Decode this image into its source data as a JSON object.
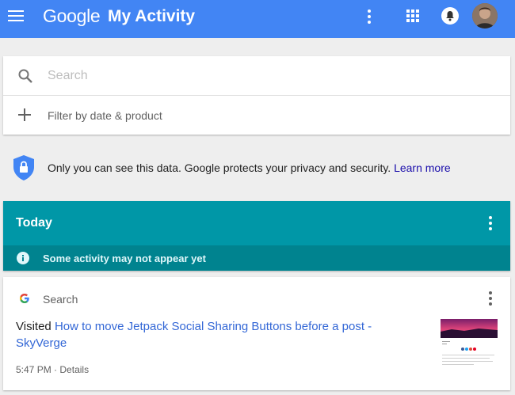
{
  "header": {
    "logo_text": "Google",
    "title": "My Activity",
    "icons": [
      "menu-icon",
      "more-vert-icon",
      "apps-grid-icon",
      "notifications-icon",
      "account-avatar"
    ],
    "brand_color": "#4285f4"
  },
  "search": {
    "placeholder": "Search",
    "value": "",
    "filter_label": "Filter by date & product"
  },
  "privacy": {
    "text": "Only you can see this data. Google protects your privacy and security.",
    "link": "Learn more"
  },
  "day_group": {
    "title": "Today",
    "notice": "Some activity may not appear yet",
    "header_color": "#0097a7",
    "notice_color": "#00838f"
  },
  "activity": {
    "product": "Search",
    "verb": "Visited",
    "link_text": "How to move Jetpack Social Sharing Buttons before a post - SkyVerge",
    "time": "5:47 PM",
    "separator": "·",
    "details": "Details",
    "link_color": "#3367d6"
  }
}
